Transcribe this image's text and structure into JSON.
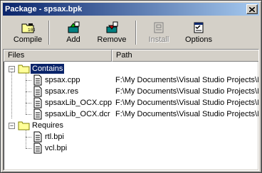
{
  "window": {
    "title": "Package - spsax.bpk"
  },
  "toolbar": {
    "compile_label": "Compile",
    "add_label": "Add",
    "remove_label": "Remove",
    "install_label": "Install",
    "options_label": "Options"
  },
  "columns": {
    "files": "Files",
    "path": "Path"
  },
  "tree": {
    "contains_label": "Contains",
    "contains_files": [
      {
        "name": "spsax.cpp",
        "path": "F:\\My Documents\\Visual Studio Projects\\E"
      },
      {
        "name": "spsax.res",
        "path": "F:\\My Documents\\Visual Studio Projects\\E"
      },
      {
        "name": "spsaxLib_OCX.cpp",
        "path": "F:\\My Documents\\Visual Studio Projects\\E"
      },
      {
        "name": "spsaxLib_OCX.dcr",
        "path": "F:\\My Documents\\Visual Studio Projects\\E"
      }
    ],
    "requires_label": "Requires",
    "requires_files": [
      {
        "name": "rtl.bpi"
      },
      {
        "name": "vcl.bpi"
      }
    ]
  },
  "icons": {
    "compile": "compile-icon",
    "add": "add-icon",
    "remove": "remove-icon",
    "install": "install-icon",
    "options": "options-icon",
    "folder": "folder-icon",
    "file": "file-icon"
  },
  "colors": {
    "title_start": "#0a246a",
    "title_end": "#a6caf0",
    "selection": "#0a246a",
    "face": "#d4d0c8"
  }
}
